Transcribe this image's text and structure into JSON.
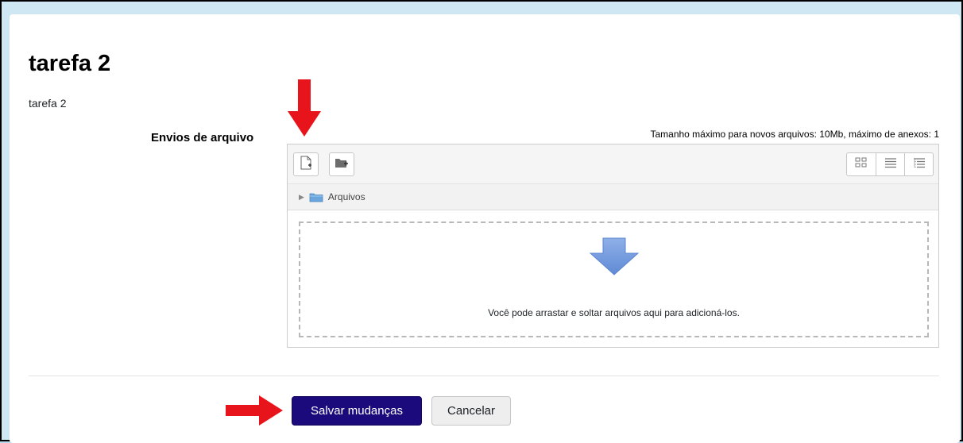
{
  "page": {
    "title": "tarefa 2",
    "description": "tarefa 2"
  },
  "form": {
    "field_label": "Envios de arquivo",
    "limits_text": "Tamanho máximo para novos arquivos: 10Mb, máximo de anexos: 1",
    "toolbar": {
      "add_file_icon": "add-file-icon",
      "create_folder_icon": "create-folder-icon",
      "views": [
        "grid-view-icon",
        "list-view-icon",
        "tree-view-icon"
      ]
    },
    "path_label": "Arquivos",
    "dropzone_text": "Você pode arrastar e soltar arquivos aqui para adicioná-los."
  },
  "buttons": {
    "save": "Salvar mudanças",
    "cancel": "Cancelar"
  },
  "colors": {
    "primary": "#1a0a7c",
    "annotation_arrow": "#e8141b",
    "drop_arrow": "#6f97dc"
  }
}
